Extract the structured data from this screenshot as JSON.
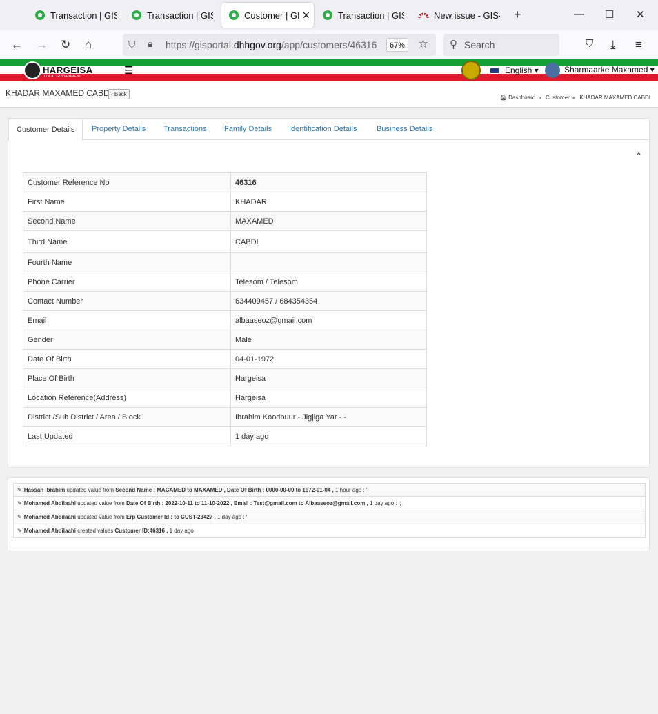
{
  "browser": {
    "tabs": [
      {
        "title": "Transaction | GIS P"
      },
      {
        "title": "Transaction | GIS P"
      },
      {
        "title": "Customer | GIS"
      },
      {
        "title": "Transaction | GIS P"
      },
      {
        "title": "New issue - GIS-H"
      }
    ],
    "url_prefix": "https://gisportal.",
    "url_domain": "dhhgov.org",
    "url_path": "/app/customers/46316",
    "zoom": "67%",
    "search_placeholder": "Search"
  },
  "app": {
    "logo_text": "HARGEISA",
    "logo_sub": "LOCAL GOVERNMENT",
    "language": "English",
    "user_name": "Sharmaarke Maxamed"
  },
  "page": {
    "title": "KHADAR MAXAMED CABDI",
    "back_label": "Back",
    "breadcrumb": [
      "Dashboard",
      "Customer",
      "KHADAR MAXAMED CABDI"
    ]
  },
  "tabs": [
    "Customer Details",
    "Property Details",
    "Transactions",
    "Family Details",
    "Identification Details",
    "Business Details"
  ],
  "customer": [
    {
      "label": "Customer Reference No",
      "value": "46316"
    },
    {
      "label": "First Name",
      "value": "KHADAR"
    },
    {
      "label": "Second Name",
      "value": "MAXAMED"
    },
    {
      "label": "Third Name",
      "value": "CABDI"
    },
    {
      "label": "Fourth Name",
      "value": ""
    },
    {
      "label": "Phone Carrier",
      "value": "Telesom / Telesom"
    },
    {
      "label": "Contact Number",
      "value": "634409457 / 684354354"
    },
    {
      "label": "Email",
      "value": "albaaseoz@gmail.com"
    },
    {
      "label": "Gender",
      "value": "Male"
    },
    {
      "label": "Date Of Birth",
      "value": "04-01-1972"
    },
    {
      "label": "Place Of Birth",
      "value": "Hargeisa"
    },
    {
      "label": "Location Reference(Address)",
      "value": "Hargeisa"
    },
    {
      "label": "District /Sub District / Area / Block",
      "value": "Ibrahim Koodbuur - Jigjiga Yar - -"
    },
    {
      "label": "Last Updated",
      "value": "1 day ago"
    }
  ],
  "activity": [
    {
      "user": "Hassan Ibrahim",
      "verb": "updated value from",
      "changes": "Second Name : MACAMED to MAXAMED , Date Of Birth : 0000-00-00 to 1972-01-04 ,",
      "time": "1 hour ago : ';"
    },
    {
      "user": "Mohamed Abdilaahi",
      "verb": "updated value from",
      "changes": "Date Of Birth : 2022-10-11 to 11-10-2022 , Email : Test@gmail.com to Albaaseoz@gmail.com ,",
      "time": "1 day ago : ';"
    },
    {
      "user": "Mohamed Abdilaahi",
      "verb": "updated value from",
      "changes": "Erp Customer Id : to CUST-23427 ,",
      "time": "1 day ago : ';"
    },
    {
      "user": "Mohamed Abdilaahi",
      "verb": "created values",
      "changes": "Customer ID:46316 ,",
      "time": "1 day ago"
    }
  ]
}
